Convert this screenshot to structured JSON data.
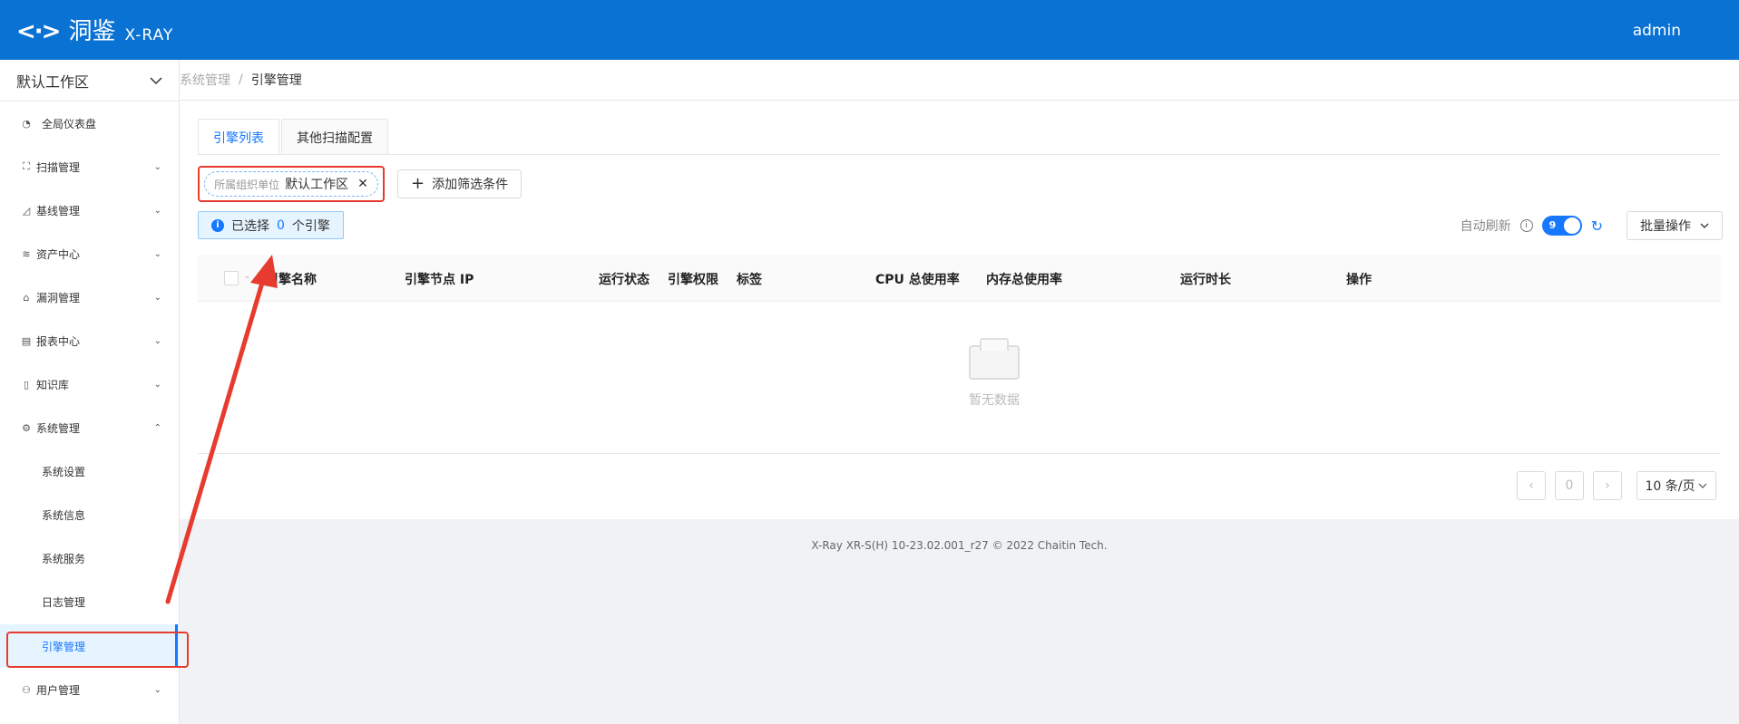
{
  "topbar": {
    "logo_glyph": "<·>",
    "logo_cn": "洞鉴",
    "logo_en": "X-RAY",
    "user": "admin"
  },
  "sidebar": {
    "workspace": "默认工作区",
    "items": [
      {
        "label": "全局仪表盘",
        "icon": "dashboard-icon"
      },
      {
        "label": "扫描管理",
        "icon": "scan-icon"
      },
      {
        "label": "基线管理",
        "icon": "baseline-icon"
      },
      {
        "label": "资产中心",
        "icon": "layers-icon"
      },
      {
        "label": "漏洞管理",
        "icon": "bug-icon"
      },
      {
        "label": "报表中心",
        "icon": "report-icon"
      },
      {
        "label": "知识库",
        "icon": "book-icon"
      },
      {
        "label": "系统管理",
        "icon": "gear-icon"
      },
      {
        "label": "系统设置"
      },
      {
        "label": "系统信息"
      },
      {
        "label": "系统服务"
      },
      {
        "label": "日志管理"
      },
      {
        "label": "引擎管理"
      },
      {
        "label": "用户管理",
        "icon": "users-icon"
      }
    ]
  },
  "breadcrumb": {
    "parent": "系统管理",
    "separator": "/",
    "current": "引擎管理"
  },
  "tabs": [
    "引擎列表",
    "其他扫描配置"
  ],
  "filter": {
    "key": "所属组织单位",
    "value": "默认工作区",
    "add_label": "添加筛选条件"
  },
  "selection": {
    "prefix": "已选择",
    "count": "0",
    "suffix": "个引擎"
  },
  "tools": {
    "auto_refresh": "自动刷新",
    "toggle_value": "9",
    "batch": "批量操作"
  },
  "table": {
    "columns": [
      "引擎名称",
      "引擎节点 IP",
      "运行状态",
      "引擎权限",
      "标签",
      "CPU 总使用率",
      "内存总使用率",
      "运行时长",
      "操作"
    ],
    "empty_text": "暂无数据"
  },
  "pagination": {
    "page": "0",
    "page_size": "10 条/页"
  },
  "footer": "X-Ray XR-S(H) 10-23.02.001_r27 © 2022 Chaitin Tech.",
  "colors": {
    "header": "#0a72d3",
    "accent": "#1677ff",
    "annotation": "#e63b2e"
  }
}
